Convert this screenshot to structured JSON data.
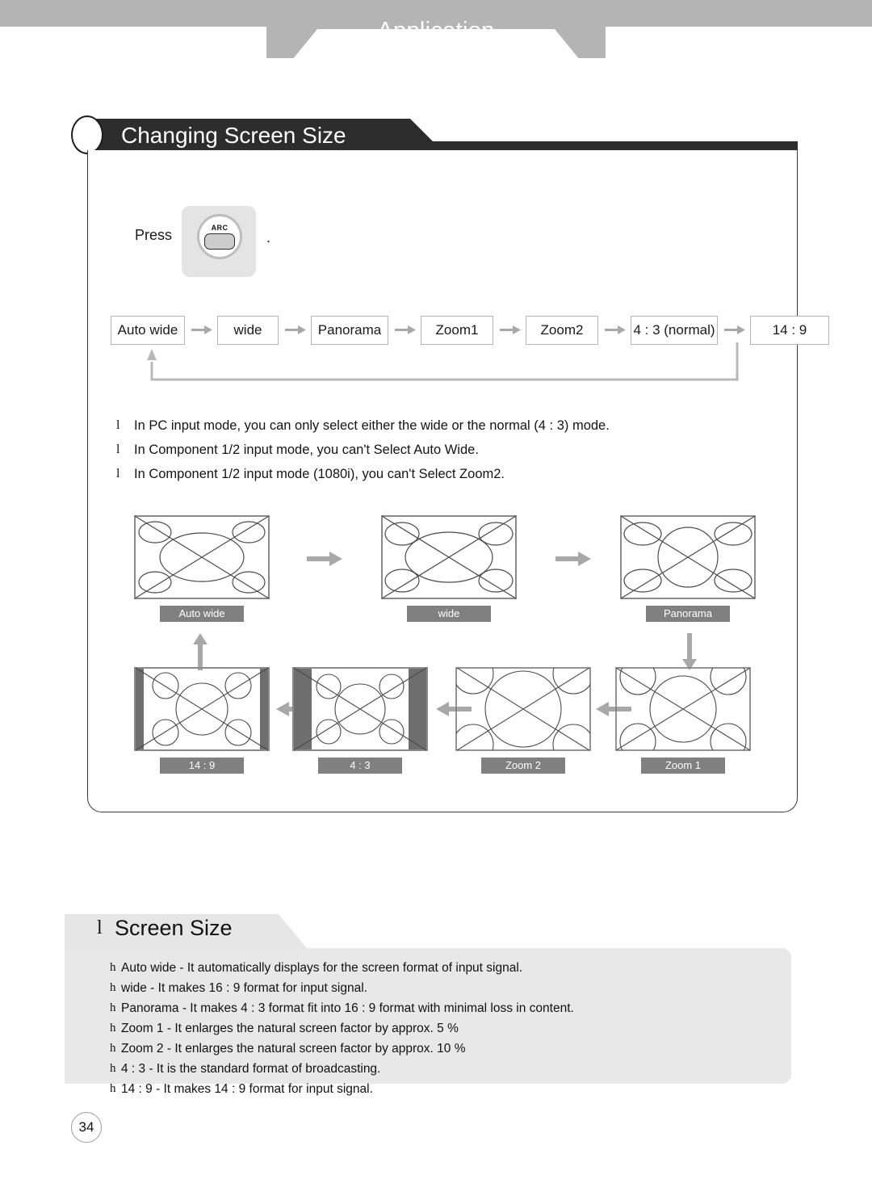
{
  "page": {
    "chapter_title": "Application",
    "page_number": "34"
  },
  "section1": {
    "title": "Changing Screen Size",
    "press": {
      "label": "Press",
      "key_label": "ARC",
      "trailing": "."
    },
    "flow": {
      "steps": [
        {
          "label": "Auto wide"
        },
        {
          "label": "wide"
        },
        {
          "label": "Panorama"
        },
        {
          "label": "Zoom1"
        },
        {
          "label": "Zoom2"
        },
        {
          "label": "4 : 3 (normal)"
        },
        {
          "label": "14 : 9"
        }
      ],
      "arrow_icon": "arrow-right-icon",
      "loop_icon": "loop-back-arrow-icon"
    },
    "notes": {
      "bullet_glyph": "l",
      "items": [
        "In PC input mode, you can only select either the wide or the normal (4 : 3) mode.",
        "In Component 1/2 input mode, you can't Select Auto Wide.",
        "In Component 1/2 input mode (1080i), you can't Select Zoom2."
      ]
    },
    "diagrams": {
      "row1": [
        {
          "label": "Auto wide",
          "mode": "wide-ellipse"
        },
        {
          "label": "wide",
          "mode": "wide-ellipse"
        },
        {
          "label": "Panorama",
          "mode": "circle"
        }
      ],
      "row2": [
        {
          "label": "14 : 9",
          "mode": "pillar-narrow"
        },
        {
          "label": "4 : 3",
          "mode": "pillar-wide"
        },
        {
          "label": "Zoom 2",
          "mode": "zoom2"
        },
        {
          "label": "Zoom 1",
          "mode": "zoom1"
        }
      ],
      "arrows": {
        "right_icon": "arrow-right-icon",
        "left_icon": "arrow-left-icon",
        "up_icon": "arrow-up-icon",
        "down_icon": "arrow-down-icon"
      }
    }
  },
  "section2": {
    "bullet_glyph": "l",
    "title": "Screen Size",
    "item_bullet_glyph": "h",
    "items": [
      "Auto wide - It automatically displays for the screen format of input signal.",
      "wide - It makes 16 : 9 format for input signal.",
      "Panorama - It makes 4 : 3 format fit into 16 : 9 format with minimal loss in content.",
      "Zoom 1 - It enlarges the natural screen factor by approx. 5 %",
      "Zoom 2 - It enlarges the natural screen factor by approx. 10 %",
      "4 : 3 - It is the standard format of broadcasting.",
      "14 : 9 - It makes 14 : 9 format for input signal."
    ]
  },
  "colors": {
    "banner_gray": "#b4b4b4",
    "header_dark": "#2d2d2d",
    "label_gray": "#808080",
    "panel_gray": "#e8e8e8",
    "arrow_gray": "#a8a8a8"
  }
}
